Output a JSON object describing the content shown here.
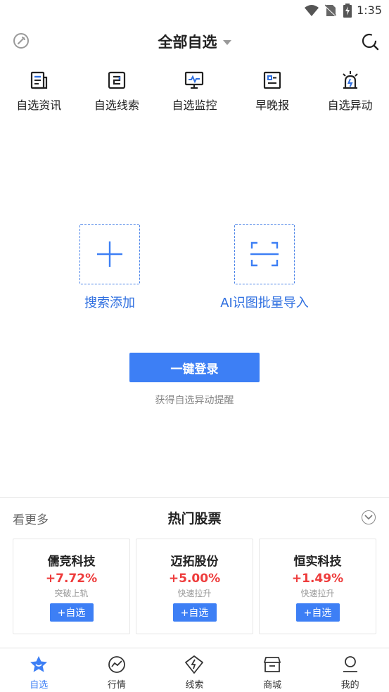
{
  "status_bar": {
    "time": "1:35"
  },
  "header": {
    "title": "全部自选"
  },
  "quick_entries": [
    {
      "label": "自选资讯",
      "icon": "news-icon"
    },
    {
      "label": "自选线索",
      "icon": "clue-icon"
    },
    {
      "label": "自选监控",
      "icon": "monitor-icon"
    },
    {
      "label": "早晚报",
      "icon": "report-icon"
    },
    {
      "label": "自选异动",
      "icon": "alarm-icon"
    }
  ],
  "empty_state": {
    "search_add_label": "搜索添加",
    "ai_import_label": "AI识图批量导入",
    "login_button": "一键登录",
    "login_hint": "获得自选异动提醒"
  },
  "hot_stocks": {
    "see_more": "看更多",
    "title": "热门股票",
    "items": [
      {
        "name": "儒竞科技",
        "change": "+7.72%",
        "tag": "突破上轨",
        "add": "+自选"
      },
      {
        "name": "迈拓股份",
        "change": "+5.00%",
        "tag": "快速拉升",
        "add": "+自选"
      },
      {
        "name": "恒实科技",
        "change": "+1.49%",
        "tag": "快速拉升",
        "add": "+自选"
      }
    ]
  },
  "bottom_nav": [
    {
      "label": "自选",
      "icon": "star-icon",
      "active": true
    },
    {
      "label": "行情",
      "icon": "trend-icon"
    },
    {
      "label": "线索",
      "icon": "lightning-icon"
    },
    {
      "label": "商城",
      "icon": "shop-icon"
    },
    {
      "label": "我的",
      "icon": "profile-icon"
    }
  ],
  "colors": {
    "accent": "#3d7ff5",
    "rise": "#ee3c3c"
  }
}
